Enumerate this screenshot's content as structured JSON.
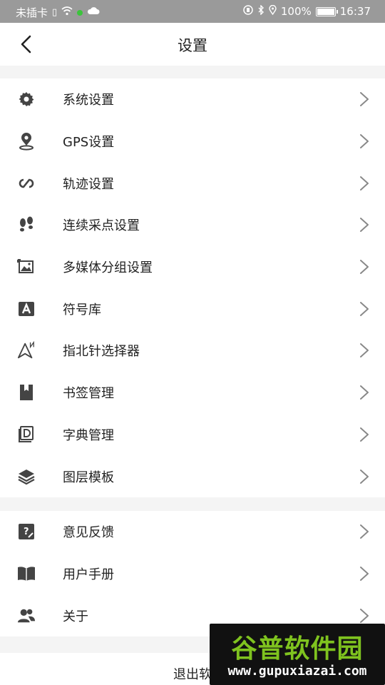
{
  "status_bar": {
    "carrier": "未插卡",
    "battery": "100%",
    "battery_level": 1.0,
    "time": "16:37"
  },
  "nav": {
    "title": "设置"
  },
  "settings_items": [
    {
      "label": "系统设置",
      "icon": "gear-icon"
    },
    {
      "label": "GPS设置",
      "icon": "location-pin-icon"
    },
    {
      "label": "轨迹设置",
      "icon": "track-loop-icon"
    },
    {
      "label": "连续采点设置",
      "icon": "footprints-icon"
    },
    {
      "label": "多媒体分组设置",
      "icon": "media-image-icon"
    },
    {
      "label": "符号库",
      "icon": "symbol-a-icon"
    },
    {
      "label": "指北针选择器",
      "icon": "north-arrow-icon"
    },
    {
      "label": "书签管理",
      "icon": "bookmark-icon"
    },
    {
      "label": "字典管理",
      "icon": "dictionary-icon"
    },
    {
      "label": "图层模板",
      "icon": "layers-icon"
    }
  ],
  "help_items": [
    {
      "label": "意见反馈",
      "icon": "feedback-icon"
    },
    {
      "label": "用户手册",
      "icon": "book-icon"
    },
    {
      "label": "关于",
      "icon": "users-icon"
    }
  ],
  "logout": {
    "label": "退出软"
  },
  "watermark": {
    "title": "谷普软件园",
    "url": "www.gupuxiazai.com"
  }
}
